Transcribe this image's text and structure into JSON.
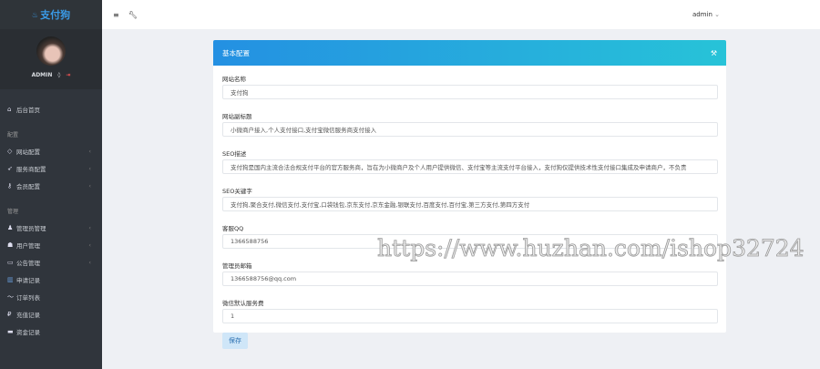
{
  "brand": "支付狗",
  "user": {
    "name": "ADMIN"
  },
  "nav": {
    "home": "后台首页",
    "section_config": "配置",
    "config_items": [
      "网站配置",
      "服务商配置",
      "会员配置"
    ],
    "section_manage": "管理",
    "manage_items": [
      "管理员管理",
      "用户管理",
      "公告管理",
      "申请记录",
      "订单列表",
      "充值记录",
      "资金记录"
    ]
  },
  "topbar": {
    "user": "admin"
  },
  "panel": {
    "title": "基本配置",
    "fields": [
      {
        "label": "网站名称",
        "value": "支付狗"
      },
      {
        "label": "网站副标题",
        "value": "小微商户接入,个人支付接口,支付宝微信服务商支付接入"
      },
      {
        "label": "SEO描述",
        "value": "支付狗是国内主流合法合规支付平台的官方服务商，旨在为小微商户及个人用户提供微信、支付宝等主流支付平台接入，支付狗仅提供技术性支付接口集成及申请商户，不负责"
      },
      {
        "label": "SEO关键字",
        "value": "支付狗,聚合支付,微信支付,支付宝,口袋钱包,京东支付,京东金融,银联支付,百度支付,百付宝,第三方支付,第四方支付"
      },
      {
        "label": "客服QQ",
        "value": "1366588756"
      },
      {
        "label": "管理员邮箱",
        "value": "1366588756@qq.com"
      },
      {
        "label": "微信默认服务费",
        "value": "1"
      }
    ],
    "save": "保存"
  },
  "watermark": "https://www.huzhan.com/ishop32724"
}
